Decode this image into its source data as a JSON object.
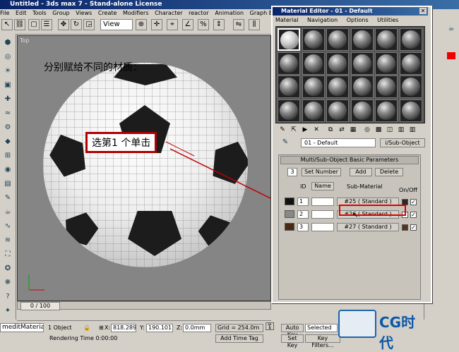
{
  "title": "Untitled - 3ds max 7 - Stand-alone License",
  "menu": [
    "File",
    "Edit",
    "Tools",
    "Group",
    "Views",
    "Create",
    "Modifiers",
    "Character",
    "reactor",
    "Animation",
    "Graph Editors"
  ],
  "toolbar": {
    "view_select": "View"
  },
  "viewport": {
    "label": "Top",
    "caption_top": "分别赋给不同的材质：",
    "caption_box": "选第1 个单击"
  },
  "timeline": {
    "frame": "0 / 100"
  },
  "status": {
    "script": "meditMaterial",
    "selection": "1 Object",
    "x_label": "X:",
    "x": "818.289",
    "y_label": "Y:",
    "y": "190.101",
    "z_label": "Z:",
    "z": "0.0mm",
    "grid": "Grid = 254.0m",
    "rendering": "Rendering Time  0:00:00",
    "add_time_tag": "Add Time Tag",
    "auto_key": "Auto Key",
    "set_key": "Set Key",
    "selected": "Selected",
    "key_filters": "Key Filters..."
  },
  "material_editor": {
    "title": "Material Editor - 01 - Default",
    "menu": [
      "Material",
      "Navigation",
      "Options",
      "Utilities"
    ],
    "material_name": "01 - Default",
    "material_type": "i/Sub-Object",
    "rollout_title": "Multi/Sub-Object Basic Parameters",
    "count": "3",
    "set_number": "Set Number",
    "add": "Add",
    "delete": "Delete",
    "headers": {
      "id": "ID",
      "name": "Name",
      "sub_material": "Sub-Material",
      "onoff": "On/Off"
    },
    "rows": [
      {
        "id": "1",
        "sub": "#25  ( Standard )",
        "color": "#2a2a2a",
        "check": "✓"
      },
      {
        "id": "2",
        "sub": "#26  ( Standard )",
        "color": "#ffffff",
        "check": "✓"
      },
      {
        "id": "3",
        "sub": "#27  ( Standard )",
        "color": "#5a3418",
        "check": "✓"
      }
    ]
  },
  "logo": {
    "text": "CG时代"
  }
}
